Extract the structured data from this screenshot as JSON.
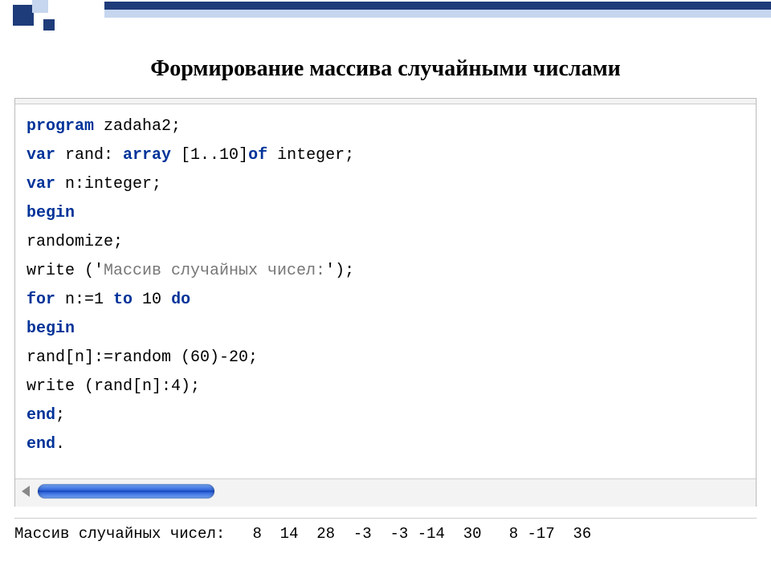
{
  "title": "Формирование массива случайными числами",
  "code": {
    "l1_kw": "program",
    "l1_txt": " zadaha2;",
    "l2_kw1": "var",
    "l2_txt1": " rand: ",
    "l2_kw2": "array",
    "l2_txt2": " [1..10]",
    "l2_kw3": "of",
    "l2_txt3": " integer;",
    "l3_kw": "var",
    "l3_txt": " n:integer;",
    "l4_kw": "begin",
    "l5_txt": "randomize;",
    "l6_txt1": "write ('",
    "l6_str": "Массив случайных чисел:",
    "l6_txt2": "');",
    "l7_kw1": "for",
    "l7_txt1": " n:=1 ",
    "l7_kw2": "to",
    "l7_txt2": " 10 ",
    "l7_kw3": "do",
    "l8_kw": "begin",
    "l9_txt": "rand[n]:=random (60)-20;",
    "l10_txt": "write (rand[n]:4);",
    "l11_kw": "end",
    "l11_txt": ";",
    "l12_kw": "end",
    "l12_txt": "."
  },
  "output": {
    "label": "Массив случайных чисел:",
    "values": "   8  14  28  -3  -3 -14  30   8 -17  36"
  }
}
